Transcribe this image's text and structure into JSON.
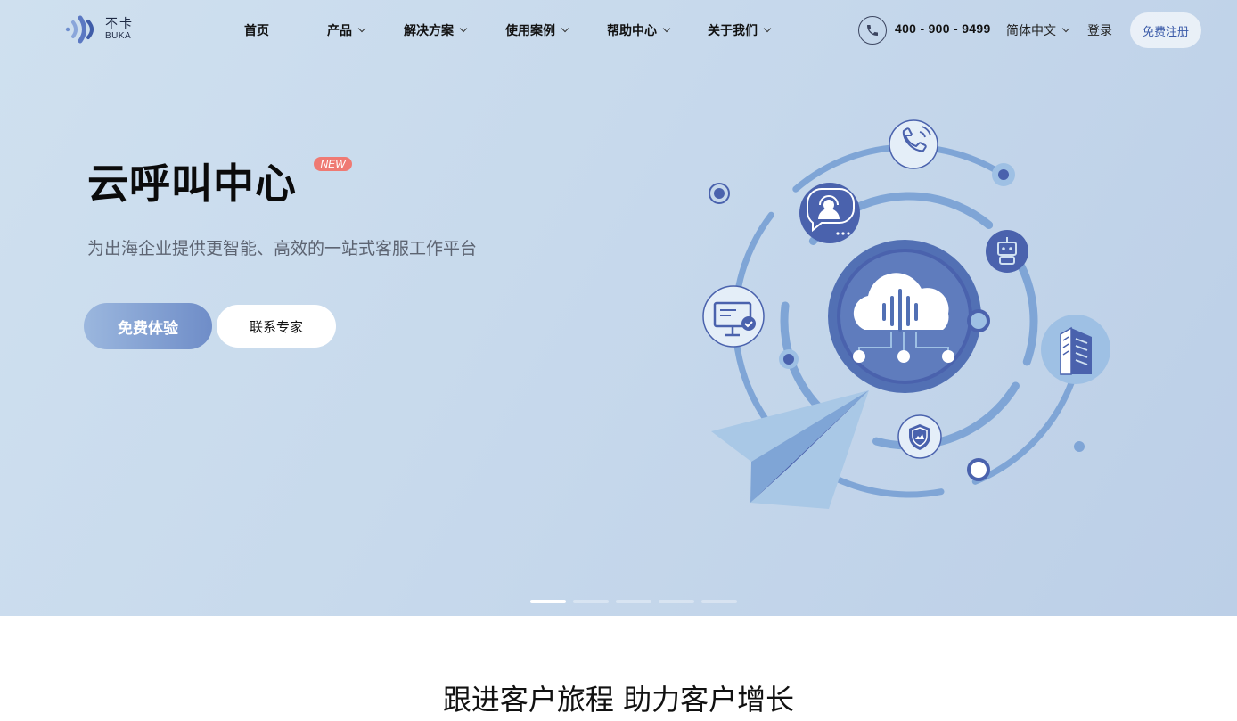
{
  "logo": {
    "cn": "不卡",
    "en": "BUKA"
  },
  "nav": {
    "items": [
      {
        "label": "首页",
        "has_dropdown": false
      },
      {
        "label": "产品",
        "has_dropdown": true
      },
      {
        "label": "解决方案",
        "has_dropdown": true
      },
      {
        "label": "使用案例",
        "has_dropdown": true
      },
      {
        "label": "帮助中心",
        "has_dropdown": true
      },
      {
        "label": "关于我们",
        "has_dropdown": true
      }
    ],
    "phone": "400 - 900 - 9499",
    "language": "简体中文",
    "login": "登录",
    "register": "免费注册"
  },
  "hero": {
    "title": "云呼叫中心",
    "badge": "NEW",
    "subtitle": "为出海企业提供更智能、高效的一站式客服工作平台",
    "primary_button": "免费体验",
    "secondary_button": "联系专家",
    "carousel": {
      "total": 5,
      "active_index": 0
    }
  },
  "section": {
    "title": "跟进客户旅程 助力客户增长"
  },
  "colors": {
    "brand": "#4a62ad",
    "accent_light": "#7ea4d6",
    "badge": "#ef7a73",
    "hero_bg": "#c7d9ec"
  },
  "icons": [
    "phone-icon",
    "headset-chat-icon",
    "robot-icon",
    "monitor-check-icon",
    "building-icon",
    "shield-icon",
    "cloud-voice-icon",
    "paper-plane-icon"
  ]
}
